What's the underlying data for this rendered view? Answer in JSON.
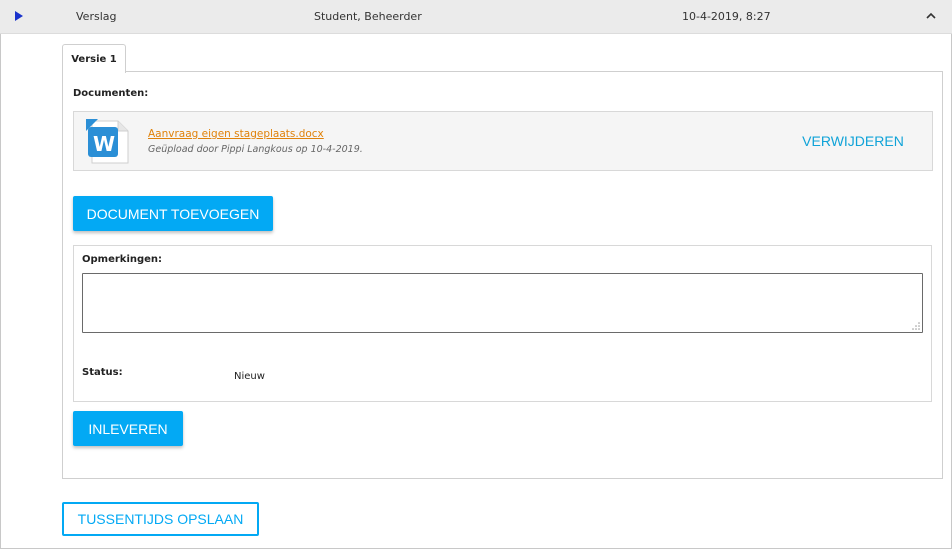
{
  "header": {
    "item_name": "Verslag",
    "roles": "Student, Beheerder",
    "datetime": "10-4-2019, 8:27",
    "expand_icon": "play-triangle-icon",
    "collapse_icon": "chevron-up-icon"
  },
  "tab": {
    "label": "Versie 1"
  },
  "documents": {
    "heading": "Documenten:",
    "file": {
      "icon": "word-document-icon",
      "name": "Aanvraag eigen stageplaats.docx",
      "meta": "Geüpload door Pippi Langkous op 10-4-2019.",
      "remove_label": "VERWIJDEREN"
    },
    "add_label": "DOCUMENT TOEVOEGEN"
  },
  "remarks": {
    "heading": "Opmerkingen:",
    "value": ""
  },
  "status": {
    "label": "Status:",
    "value": "Nieuw"
  },
  "actions": {
    "submit_label": "INLEVEREN",
    "save_draft_label": "TUSSENTIJDS OPSLAAN"
  },
  "colors": {
    "accent": "#03a9f4",
    "link": "#e0820a",
    "header_bg": "#ebebeb"
  }
}
